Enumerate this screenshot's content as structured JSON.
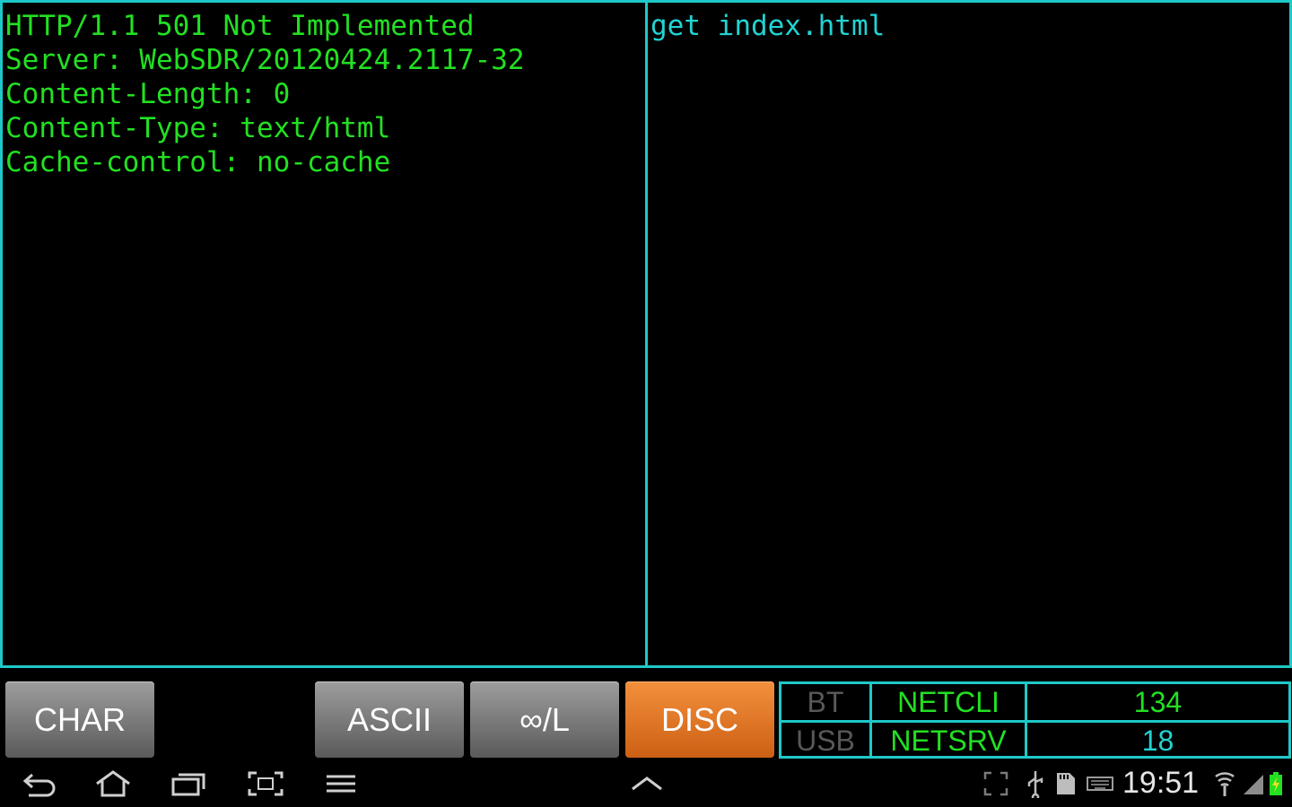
{
  "left_pane": {
    "lines": [
      "HTTP/1.1 501 Not Implemented",
      "Server: WebSDR/20120424.2117-32",
      "Content-Length: 0",
      "Content-Type: text/html",
      "Cache-control: no-cache"
    ]
  },
  "right_pane": {
    "lines": [
      "get index.html"
    ]
  },
  "controls": {
    "char_label": "CHAR",
    "ascii_label": "ASCII",
    "loop_label": "∞/L",
    "disc_label": "DISC"
  },
  "status": {
    "bt_label": "BT",
    "usb_label": "USB",
    "netcli_label": "NETCLI",
    "netsrv_label": "NETSRV",
    "netcli_count": "134",
    "netsrv_count": "18"
  },
  "system_bar": {
    "time": "19:51",
    "icons": [
      "back-icon",
      "home-icon",
      "recent-apps-icon",
      "screenshot-icon",
      "menu-icon",
      "up-chevron-icon",
      "fullscreen-icon",
      "usb-icon",
      "sd-card-icon",
      "keyboard-icon",
      "wifi-icon",
      "signal-icon",
      "battery-icon"
    ]
  },
  "colors": {
    "border": "#1fc8c8",
    "rx_text": "#22e022",
    "tx_text": "#22d3d3",
    "disc_button": "#e87a2a",
    "button_gray": "#7a7a7a"
  }
}
